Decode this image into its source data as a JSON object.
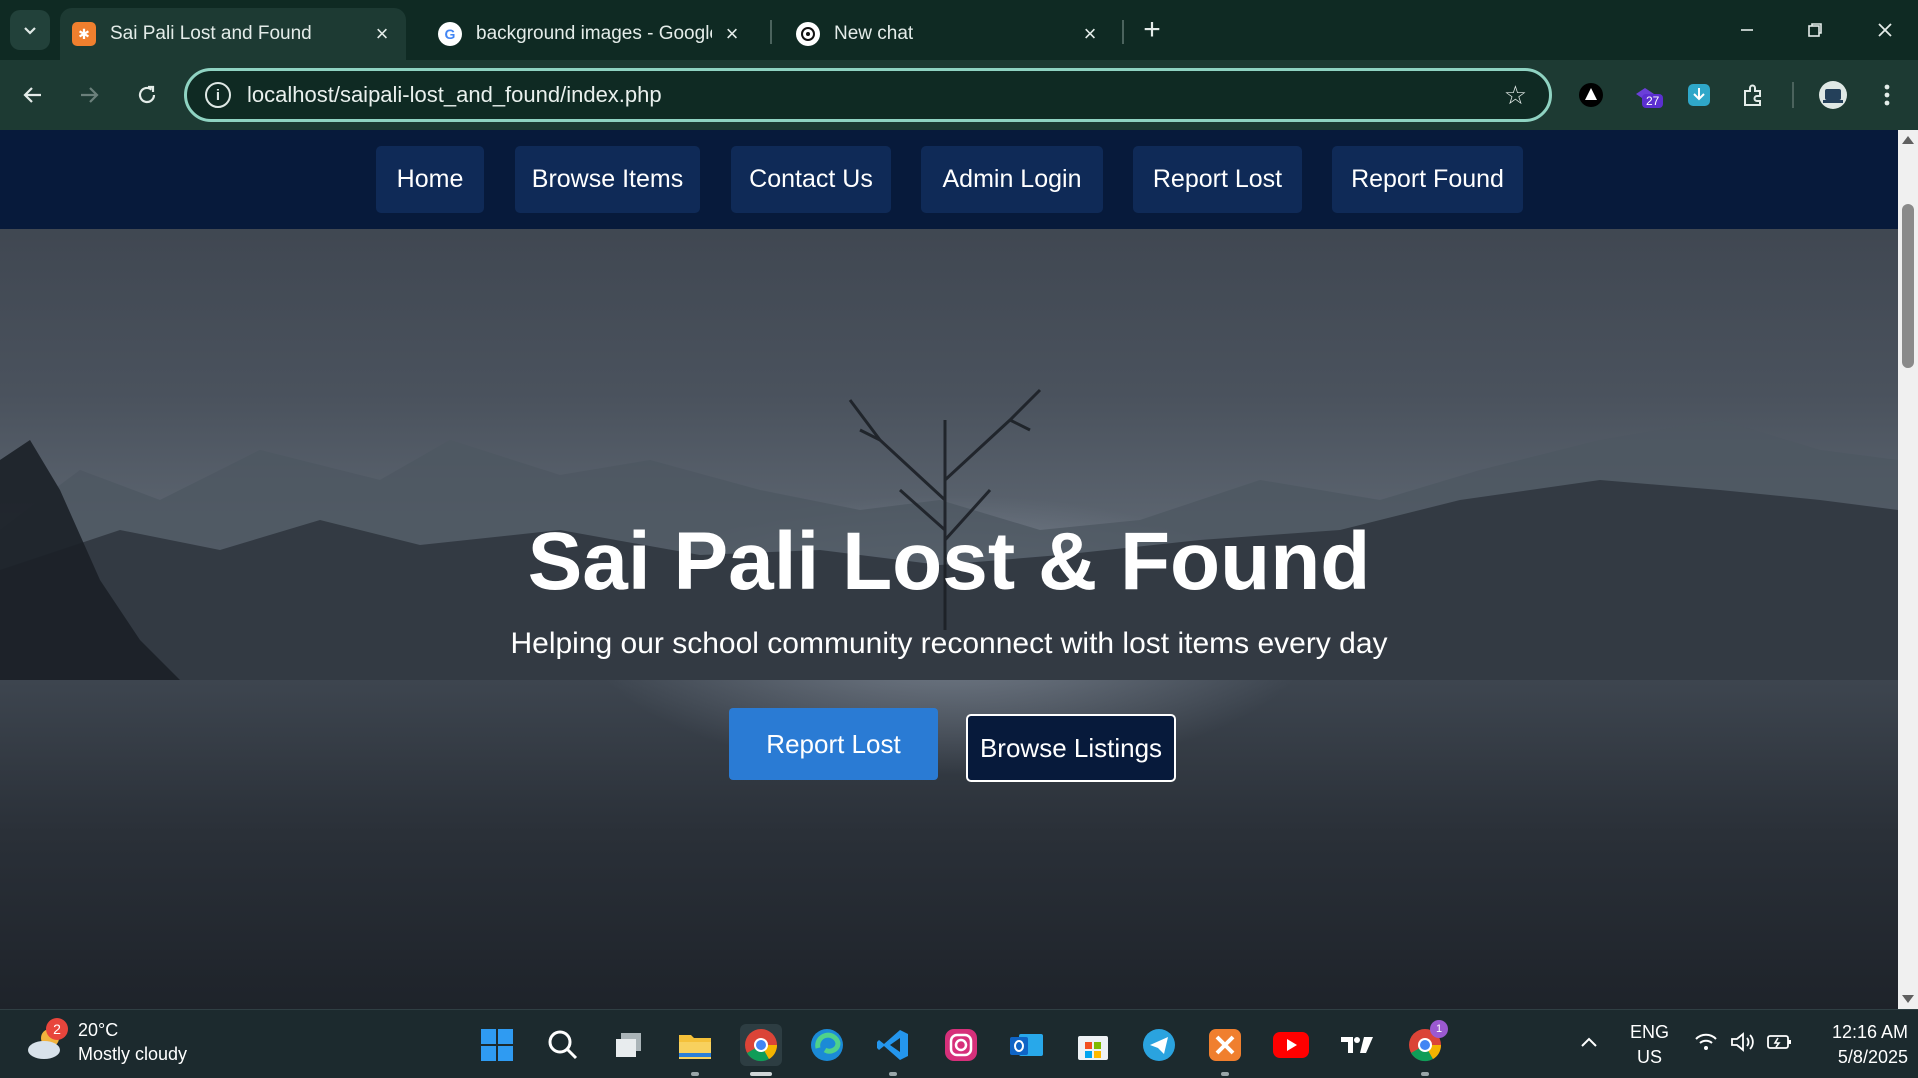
{
  "browser": {
    "tabs": [
      {
        "title": "Sai Pali Lost and Found",
        "active": true,
        "icon": "xampp-icon"
      },
      {
        "title": "background images - Google S",
        "active": false,
        "icon": "google-icon"
      },
      {
        "title": "New chat",
        "active": false,
        "icon": "chatgpt-icon"
      }
    ],
    "url": "localhost/saipali-lost_and_found/index.php",
    "extension_badge": "27"
  },
  "site": {
    "nav": [
      "Home",
      "Browse Items",
      "Contact Us",
      "Admin Login",
      "Report Lost",
      "Report Found"
    ],
    "hero_title": "Sai Pali Lost & Found",
    "hero_subtitle": "Helping our school community reconnect with lost items every day",
    "primary_cta": "Report Lost",
    "secondary_cta": "Browse Listings"
  },
  "taskbar": {
    "weather_temp": "20°C",
    "weather_desc": "Mostly cloudy",
    "weather_badge": "2",
    "lang_line1": "ENG",
    "lang_line2": "US",
    "time": "12:16 AM",
    "date": "5/8/2025",
    "chrome_badge": "1"
  },
  "colors": {
    "site_nav_bg": "#071a3b",
    "nav_button_bg": "#0f2a57",
    "primary_button": "#2a7bd4",
    "browser_frame": "#0f2a23",
    "omnibox_focus": "#8fd3c2"
  }
}
